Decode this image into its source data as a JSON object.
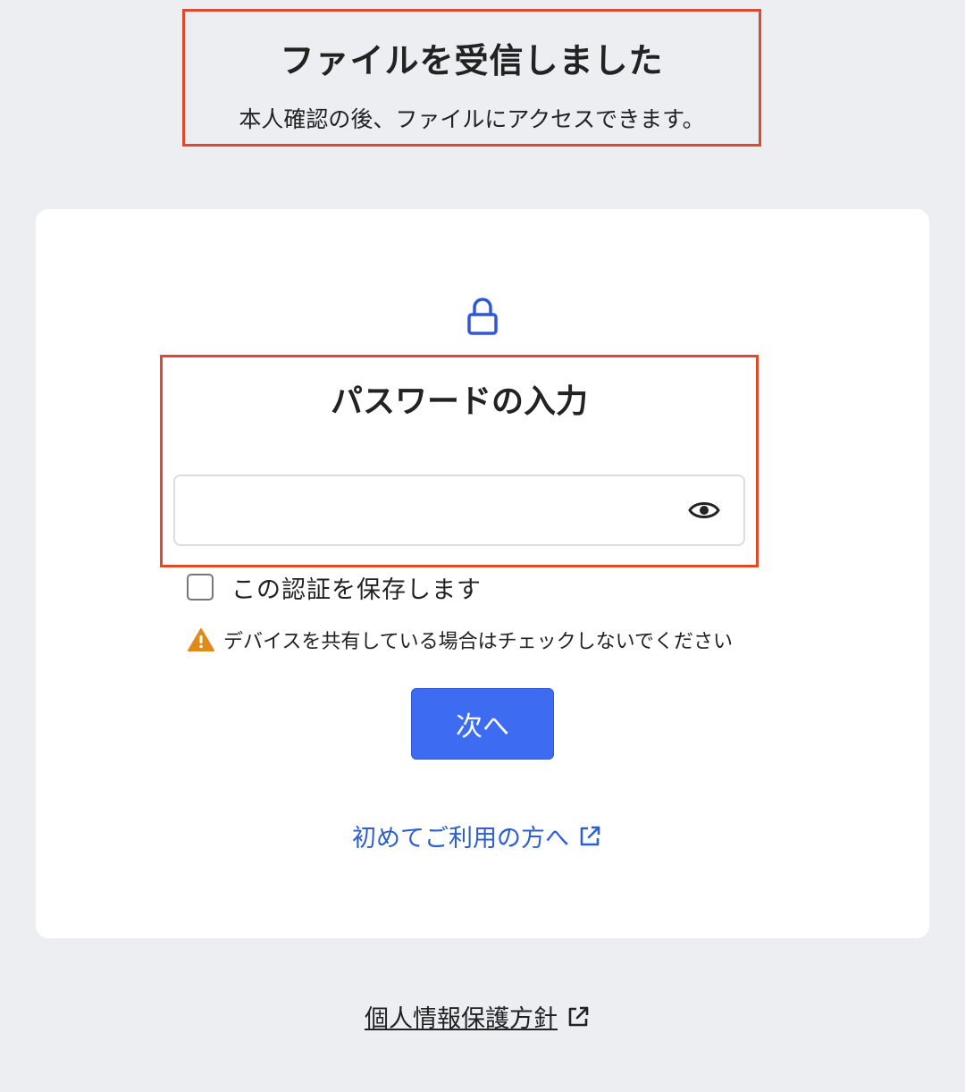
{
  "header": {
    "title": "ファイルを受信しました",
    "subtitle": "本人確認の後、ファイルにアクセスできます。"
  },
  "login": {
    "title": "パスワードの入力",
    "password_value": "",
    "remember_label": "この認証を保存します",
    "remember_checked": false,
    "warning_text": "デバイスを共有している場合はチェックしないでください",
    "next_label": "次へ",
    "first_time_link": "初めてご利用の方へ"
  },
  "footer": {
    "privacy_link": "個人情報保護方針"
  },
  "icons": {
    "lock": "lock-icon",
    "eye": "eye-icon",
    "warning": "warning-icon",
    "external": "external-link-icon"
  },
  "colors": {
    "accent": "#3d6bf2",
    "link": "#2e5fcf",
    "highlight": "#e2492a",
    "warning": "#e08a1e",
    "background": "#eceef2"
  }
}
